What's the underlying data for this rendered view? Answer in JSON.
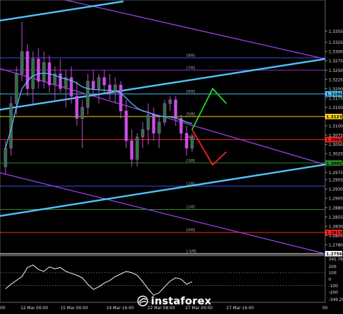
{
  "chart_data": {
    "type": "candlestick",
    "title": "",
    "price_panel": {
      "ylim": [
        1.2756,
        1.3435
      ],
      "y_tick_labels": [
        "1.3355",
        "1.3325",
        "1.3300",
        "1.3275",
        "1.3250",
        "1.3225",
        "1.3200",
        "1.3175",
        "1.3150",
        "1.3125",
        "1.3100",
        "1.3075",
        "1.3050",
        "1.3025",
        "1.3000",
        "1.2975",
        "1.2955",
        "1.2930",
        "1.2905",
        "1.2880",
        "1.2855",
        "1.2830",
        "1.2805",
        "1.2780",
        "1.2756"
      ],
      "horizontal_levels": [
        {
          "price": 1.3283,
          "color": "#3b4be8",
          "label": ""
        },
        {
          "price": 1.325,
          "color": "#8b2fc9",
          "label": ""
        },
        {
          "price": 1.3186,
          "color": "#4fc3f7",
          "label": "1.3186"
        },
        {
          "price": 1.3125,
          "color": "#ffd21f",
          "label": "1.3123"
        },
        {
          "price": 1.3063,
          "color": "#ff2222",
          "label": "1.3063"
        },
        {
          "price": 1.3,
          "color": "#2e8b2e",
          "label": "1.3000"
        },
        {
          "price": 1.2938,
          "color": "#3b4be8",
          "label": ""
        },
        {
          "price": 1.2875,
          "color": "#2e8b2e",
          "label": ""
        },
        {
          "price": 1.2813,
          "color": "#ff2222",
          "label": "1.2813"
        },
        {
          "price": 1.2756,
          "color": "#ffffff",
          "label": "1.2756"
        }
      ],
      "murrey_labels": [
        {
          "price": 1.3283,
          "text": "[8/8]"
        },
        {
          "price": 1.325,
          "text": "[7/8]"
        },
        {
          "price": 1.3186,
          "text": "[6/8]"
        },
        {
          "price": 1.3125,
          "text": "[5/8]"
        },
        {
          "price": 1.3063,
          "text": "[4/8]"
        },
        {
          "price": 1.3,
          "text": "[3/8]"
        },
        {
          "price": 1.2938,
          "text": "[2/8]"
        },
        {
          "price": 1.2875,
          "text": "[1/8]"
        },
        {
          "price": 1.2813,
          "text": "[0/8]"
        },
        {
          "price": 1.2756,
          "text": "[-1/8]"
        }
      ],
      "candles": [
        {
          "o": 1.299,
          "h": 1.306,
          "l": 1.297,
          "c": 1.304
        },
        {
          "o": 1.304,
          "h": 1.318,
          "l": 1.302,
          "c": 1.316
        },
        {
          "o": 1.316,
          "h": 1.326,
          "l": 1.313,
          "c": 1.324
        },
        {
          "o": 1.324,
          "h": 1.338,
          "l": 1.322,
          "c": 1.33
        },
        {
          "o": 1.33,
          "h": 1.332,
          "l": 1.318,
          "c": 1.32
        },
        {
          "o": 1.32,
          "h": 1.33,
          "l": 1.316,
          "c": 1.328
        },
        {
          "o": 1.328,
          "h": 1.331,
          "l": 1.32,
          "c": 1.322
        },
        {
          "o": 1.322,
          "h": 1.33,
          "l": 1.32,
          "c": 1.327
        },
        {
          "o": 1.327,
          "h": 1.329,
          "l": 1.319,
          "c": 1.321
        },
        {
          "o": 1.321,
          "h": 1.326,
          "l": 1.317,
          "c": 1.324
        },
        {
          "o": 1.324,
          "h": 1.328,
          "l": 1.319,
          "c": 1.32
        },
        {
          "o": 1.32,
          "h": 1.325,
          "l": 1.315,
          "c": 1.323
        },
        {
          "o": 1.323,
          "h": 1.326,
          "l": 1.316,
          "c": 1.318
        },
        {
          "o": 1.318,
          "h": 1.322,
          "l": 1.31,
          "c": 1.312
        },
        {
          "o": 1.312,
          "h": 1.317,
          "l": 1.304,
          "c": 1.315
        },
        {
          "o": 1.315,
          "h": 1.324,
          "l": 1.313,
          "c": 1.322
        },
        {
          "o": 1.322,
          "h": 1.325,
          "l": 1.318,
          "c": 1.32
        },
        {
          "o": 1.32,
          "h": 1.324,
          "l": 1.316,
          "c": 1.323
        },
        {
          "o": 1.323,
          "h": 1.325,
          "l": 1.319,
          "c": 1.321
        },
        {
          "o": 1.321,
          "h": 1.324,
          "l": 1.317,
          "c": 1.319
        },
        {
          "o": 1.319,
          "h": 1.323,
          "l": 1.316,
          "c": 1.321
        },
        {
          "o": 1.321,
          "h": 1.322,
          "l": 1.312,
          "c": 1.314
        },
        {
          "o": 1.314,
          "h": 1.317,
          "l": 1.304,
          "c": 1.306
        },
        {
          "o": 1.306,
          "h": 1.309,
          "l": 1.299,
          "c": 1.301
        },
        {
          "o": 1.301,
          "h": 1.308,
          "l": 1.299,
          "c": 1.307
        },
        {
          "o": 1.307,
          "h": 1.311,
          "l": 1.304,
          "c": 1.309
        },
        {
          "o": 1.309,
          "h": 1.316,
          "l": 1.305,
          "c": 1.313
        },
        {
          "o": 1.313,
          "h": 1.315,
          "l": 1.306,
          "c": 1.308
        },
        {
          "o": 1.308,
          "h": 1.313,
          "l": 1.304,
          "c": 1.311
        },
        {
          "o": 1.311,
          "h": 1.317,
          "l": 1.31,
          "c": 1.316
        },
        {
          "o": 1.316,
          "h": 1.318,
          "l": 1.314,
          "c": 1.317
        },
        {
          "o": 1.317,
          "h": 1.318,
          "l": 1.31,
          "c": 1.312
        },
        {
          "o": 1.312,
          "h": 1.313,
          "l": 1.306,
          "c": 1.308
        },
        {
          "o": 1.308,
          "h": 1.31,
          "l": 1.302,
          "c": 1.304
        },
        {
          "o": 1.304,
          "h": 1.308,
          "l": 1.303,
          "c": 1.307
        }
      ],
      "moving_average": [
        1.304,
        1.309,
        1.315,
        1.32,
        1.322,
        1.3235,
        1.324,
        1.3242,
        1.324,
        1.3236,
        1.323,
        1.3226,
        1.3222,
        1.3215,
        1.3205,
        1.32,
        1.3198,
        1.3197,
        1.3196,
        1.3195,
        1.3194,
        1.3188,
        1.3175,
        1.316,
        1.3148,
        1.314,
        1.3136,
        1.313,
        1.3126,
        1.3125,
        1.3124,
        1.3121,
        1.3116,
        1.311,
        1.3106
      ],
      "forecast_up": [
        [
          1.309,
          1.32
        ],
        [
          1.32,
          1.316
        ]
      ],
      "forecast_down": [
        [
          1.309,
          1.2995
        ],
        [
          1.2995,
          1.303
        ]
      ]
    },
    "oscillator_panel": {
      "ylim": [
        -349.291,
        341.768
      ],
      "y_tick_labels": [
        "341.768",
        "200",
        "100",
        "0",
        "-100",
        "-200",
        "-349.291"
      ],
      "values": [
        -150,
        -80,
        -20,
        40,
        180,
        220,
        150,
        120,
        190,
        160,
        180,
        120,
        90,
        60,
        20,
        -80,
        -160,
        -120,
        -60,
        -20,
        40,
        80,
        120,
        100,
        60,
        -40,
        -150,
        -250,
        -210,
        -120,
        -30,
        20,
        0,
        -80,
        -40
      ]
    },
    "x_tick_labels": [
      "00",
      "12 Mar 00:00",
      "15 Mar 00:00",
      "19 Mar 16:00",
      "22 Mar 08:00",
      "27 Mar 00:00",
      "27 Mar 16:00",
      "00"
    ]
  },
  "watermark": {
    "text": "instaforex"
  },
  "colors": {
    "background": "#000000",
    "candle": "#c84fe0",
    "ma": "#4fc3f7",
    "channel": "#4fc3f7",
    "wedge": "#8a3ad6",
    "up_arrow": "#22dd22",
    "down_arrow": "#ff2222"
  }
}
